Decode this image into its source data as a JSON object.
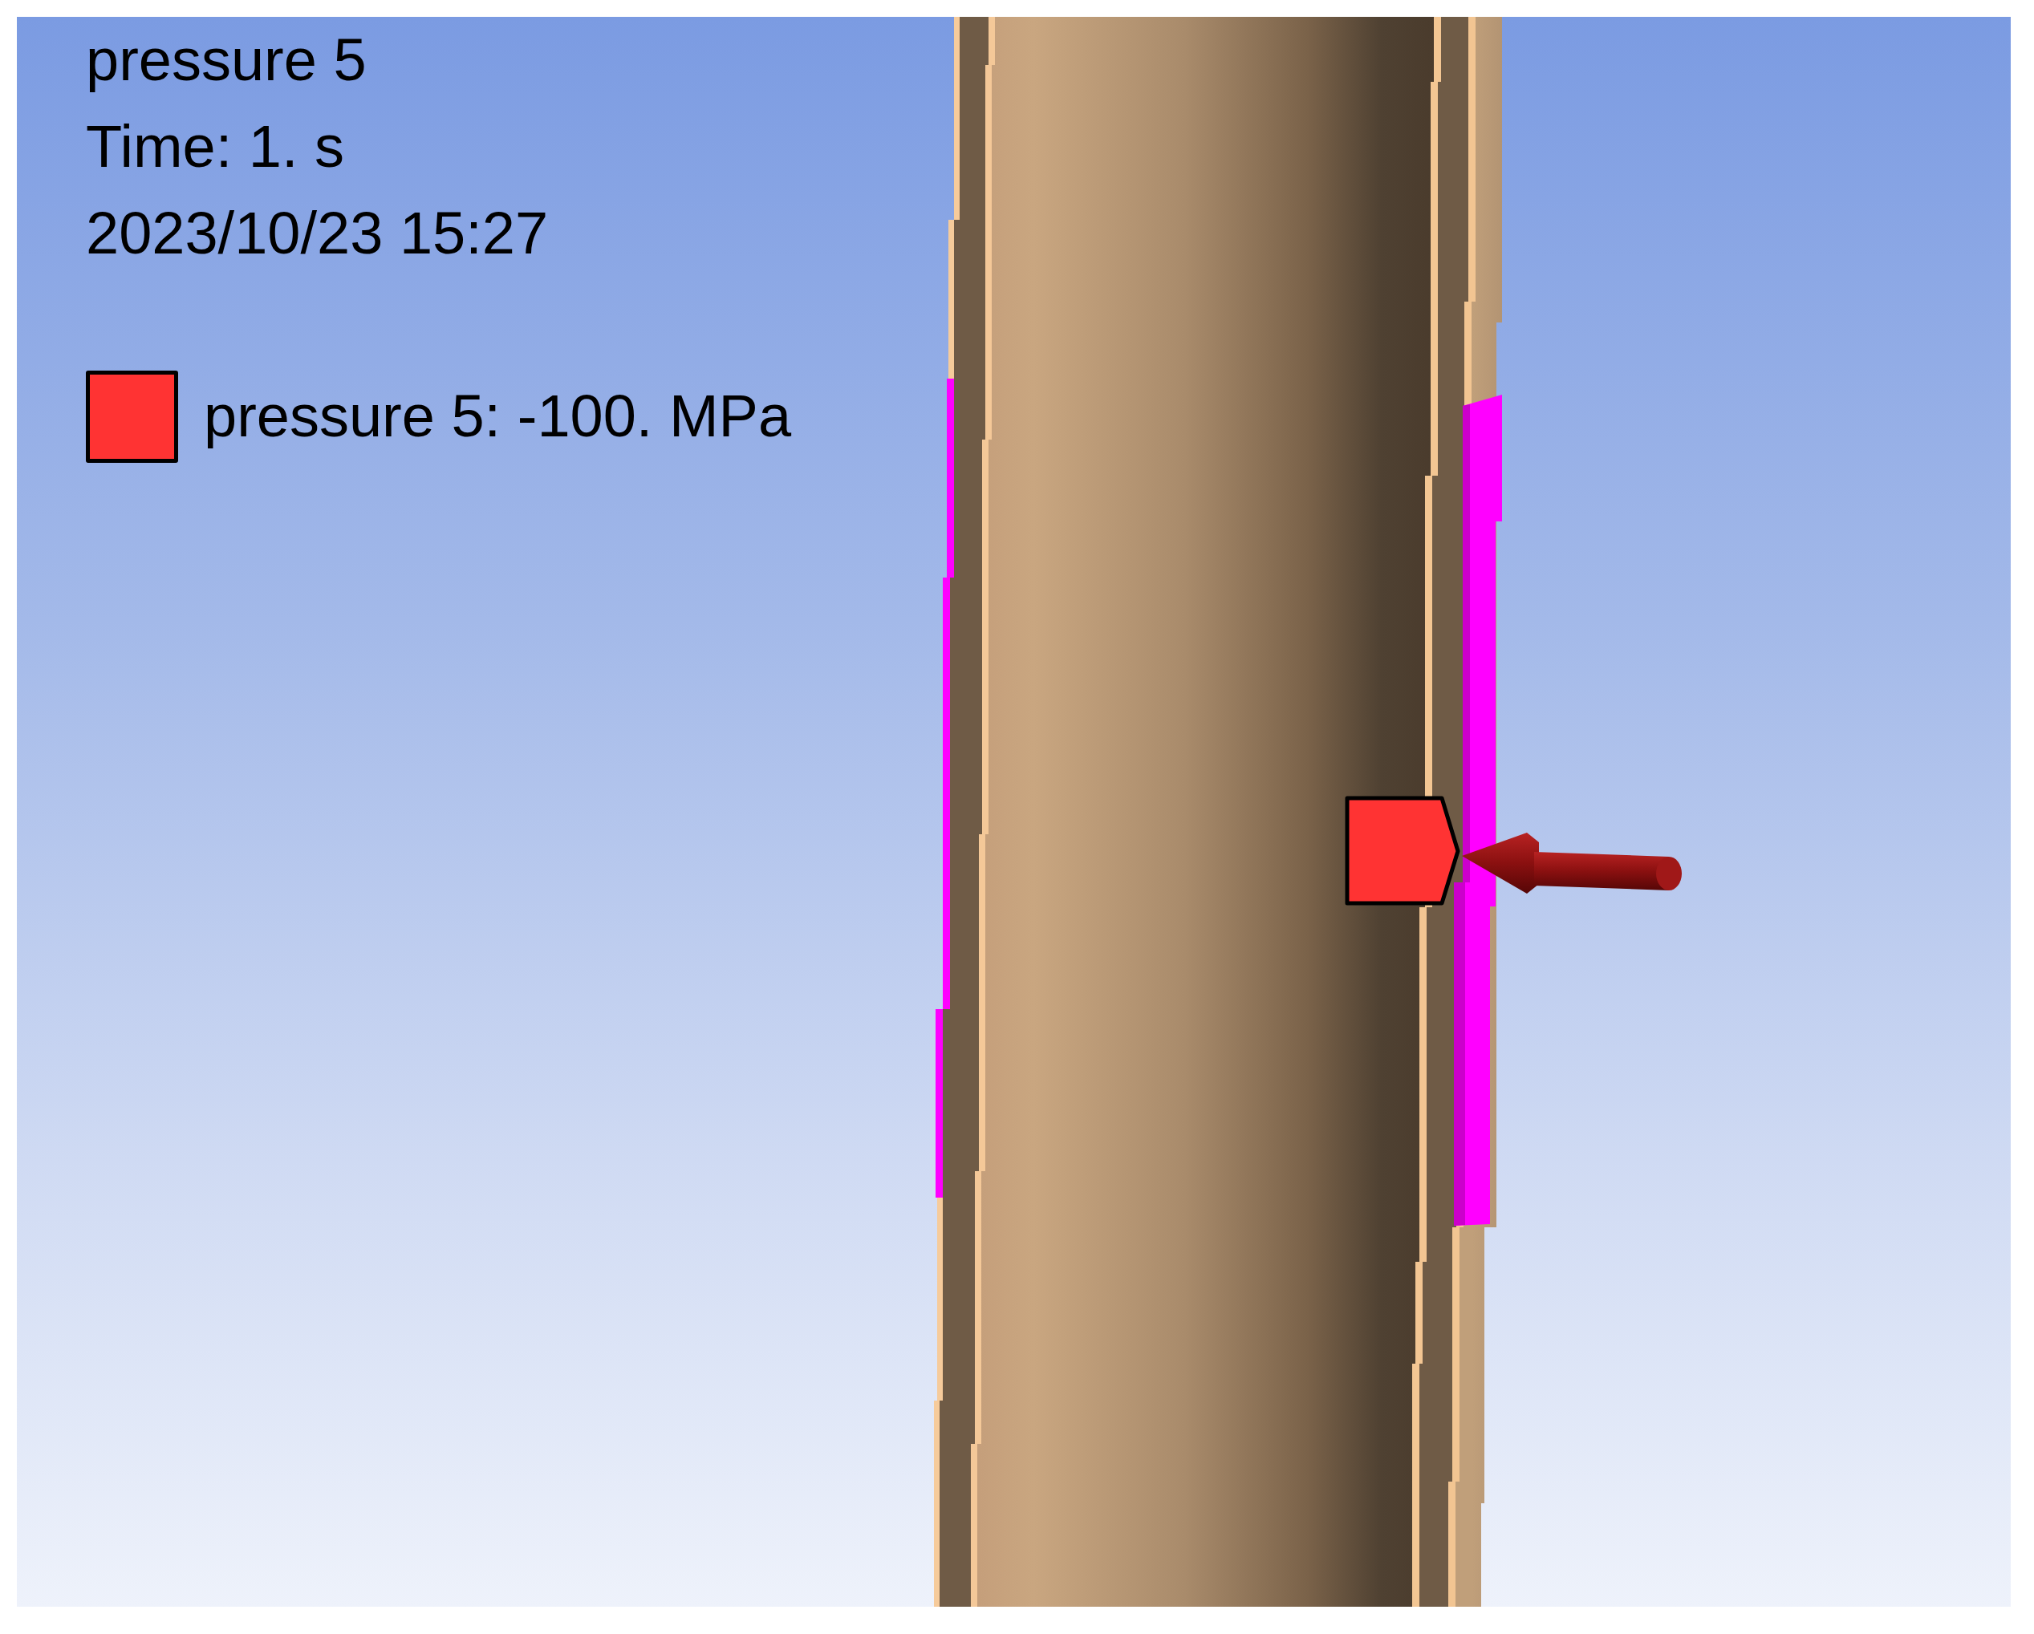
{
  "viewport": {
    "title": "pressure 5",
    "time": "Time: 1. s",
    "timestamp": "2023/10/23 15:27",
    "legend": [
      {
        "label": "pressure 5: -100. MPa",
        "color": "#ff3333"
      }
    ]
  }
}
